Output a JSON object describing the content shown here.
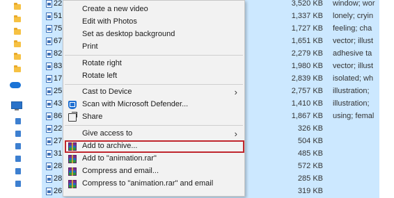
{
  "file_list": {
    "rows": [
      {
        "num": "22",
        "size": "3,520 KB",
        "tags": "window; wor"
      },
      {
        "num": "51",
        "size": "1,337 KB",
        "tags": "lonely; cryin"
      },
      {
        "num": "75",
        "size": "1,727 KB",
        "tags": "feeling; cha"
      },
      {
        "num": "67",
        "size": "1,651 KB",
        "tags": "vector; illust"
      },
      {
        "num": "82",
        "size": "2,279 KB",
        "tags": "adhesive ta"
      },
      {
        "num": "83",
        "size": "1,980 KB",
        "tags": "vector; illust"
      },
      {
        "num": "17",
        "size": "2,839 KB",
        "tags": "isolated; wh"
      },
      {
        "num": "25",
        "size": "2,757 KB",
        "tags": "illustration;"
      },
      {
        "num": "43",
        "size": "1,410 KB",
        "tags": "illustration;"
      },
      {
        "num": "86",
        "size": "1,867 KB",
        "tags": "using; femal"
      },
      {
        "num": "22",
        "size": "326 KB",
        "tags": ""
      },
      {
        "num": "27",
        "size": "504 KB",
        "tags": ""
      },
      {
        "num": "31",
        "size": "485 KB",
        "tags": ""
      },
      {
        "num": "28",
        "size": "572 KB",
        "tags": ""
      },
      {
        "num": "28",
        "size": "285 KB",
        "tags": ""
      },
      {
        "num": "26",
        "size": "319 KB",
        "tags": ""
      }
    ]
  },
  "context_menu": {
    "items": [
      {
        "label": "Create a new video"
      },
      {
        "label": "Edit with Photos"
      },
      {
        "label": "Set as desktop background"
      },
      {
        "label": "Print"
      },
      {
        "label": "Rotate right"
      },
      {
        "label": "Rotate left"
      },
      {
        "label": "Cast to Device"
      },
      {
        "label": "Scan with Microsoft Defender..."
      },
      {
        "label": "Share"
      },
      {
        "label": "Give access to"
      },
      {
        "label": "Add to archive..."
      },
      {
        "label": "Add to \"animation.rar\""
      },
      {
        "label": "Compress and email..."
      },
      {
        "label": "Compress to \"animation.rar\" and email"
      }
    ],
    "submenu_arrow": "›",
    "highlight_color": "#c0262d"
  },
  "colors": {
    "selection": "#cce8ff",
    "menu_bg": "#f2f2f2"
  }
}
